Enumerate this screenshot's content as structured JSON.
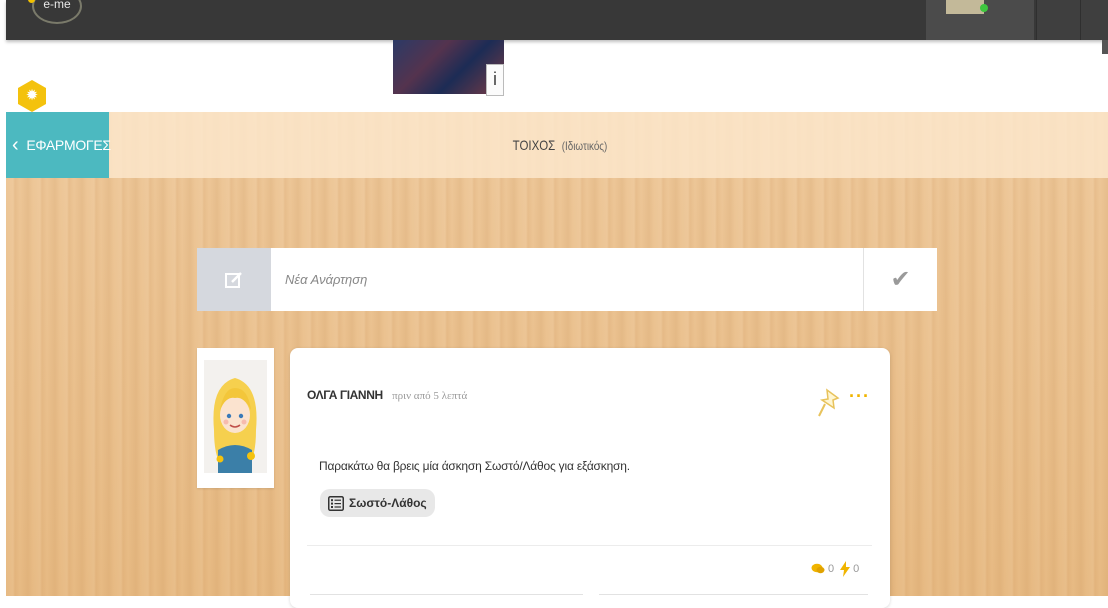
{
  "app": {
    "logo_text": "e-me"
  },
  "info_button": {
    "label": "i"
  },
  "apps_button": {
    "label": "ΕΦΑΡΜΟΓΕΣ"
  },
  "wall": {
    "title": "ΤΟΙΧΟΣ",
    "subtitle": "(Ιδιωτικός)"
  },
  "new_post": {
    "placeholder": "Νέα Ανάρτηση"
  },
  "post": {
    "author": "ΟΛΓΑ ΓΙΑΝΝΗ",
    "time": "πριν από 5 λεπτά",
    "text": "Παρακάτω θα βρεις μία άσκηση Σωστό/Λάθος για εξάσκηση.",
    "activity_label": "Σωστό-Λάθος",
    "comments_count": "0",
    "likes_count": "0",
    "more_label": "···"
  },
  "colors": {
    "accent_teal": "#4cb9c0",
    "accent_yellow": "#f4c20d",
    "top_bar": "#383838",
    "wood": "#eec89a"
  },
  "icons": {
    "settings": "gear-icon",
    "back": "chevron-left-icon",
    "compose": "edit-icon",
    "submit": "check-icon",
    "pin": "pin-icon",
    "comments": "comment-icon",
    "likes": "lightning-icon",
    "activity": "list-icon"
  }
}
